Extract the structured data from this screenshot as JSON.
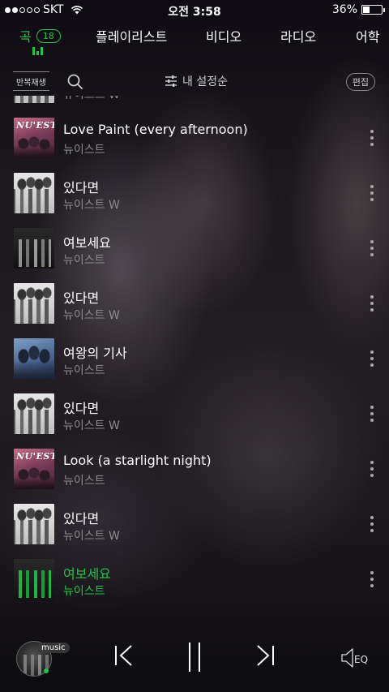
{
  "status_bar": {
    "carrier": "SKT",
    "time": "오전 3:58",
    "battery": "36%",
    "battery_level": 0.36
  },
  "tabs": {
    "song": "곡",
    "song_count": "18",
    "playlist": "플레이리스트",
    "video": "비디오",
    "radio": "라디오",
    "language": "어학"
  },
  "toolbar": {
    "repeat_label": "반복재생",
    "sort_label": "내 설정순",
    "edit_label": "편집"
  },
  "tracks": [
    {
      "title": "",
      "artist": "뉴이스트 W",
      "art": "w"
    },
    {
      "title": "Love Paint (every afternoon)",
      "artist": "뉴이스트",
      "art": "nuest",
      "art_text": "NU'EST"
    },
    {
      "title": "있다면",
      "artist": "뉴이스트 W",
      "art": "w"
    },
    {
      "title": "여보세요",
      "artist": "뉴이스트",
      "art": "hello"
    },
    {
      "title": "있다면",
      "artist": "뉴이스트 W",
      "art": "w"
    },
    {
      "title": "여왕의 기사",
      "artist": "뉴이스트",
      "art": "queen"
    },
    {
      "title": "있다면",
      "artist": "뉴이스트 W",
      "art": "w"
    },
    {
      "title": "Look (a starlight night)",
      "artist": "뉴이스트",
      "art": "nuest",
      "art_text": "NU'EST"
    },
    {
      "title": "있다면",
      "artist": "뉴이스트 W",
      "art": "w"
    },
    {
      "title": "여보세요",
      "artist": "뉴이스트",
      "art": "hello",
      "playing": true
    }
  ],
  "player": {
    "music_tag": "music",
    "eq_label": "EQ"
  },
  "colors": {
    "accent": "#21c44b",
    "secondary_text": "#8a8a8a"
  },
  "icons": [
    "wifi-icon",
    "battery-icon",
    "search-icon",
    "sort-icon",
    "more-icon",
    "previous-icon",
    "pause-icon",
    "next-icon",
    "eq-icon"
  ]
}
